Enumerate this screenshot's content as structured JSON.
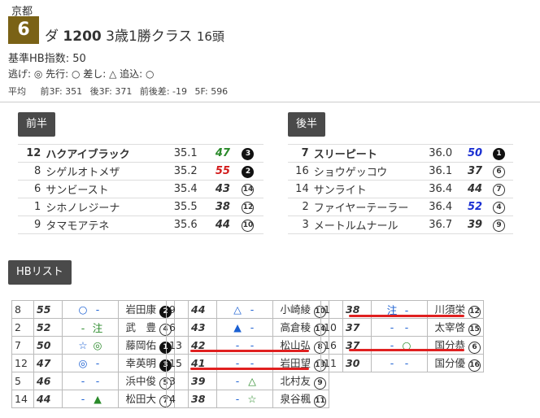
{
  "race": {
    "venue": "京都",
    "number": "6",
    "track": "ダ",
    "distance": "1200",
    "class_name": "3歳1勝クラス",
    "runners": "16頭",
    "hb_index": "基準HB指数: 50",
    "style_legend": "逃げ: ◎ 先行: ○ 差し: △ 追込: ○",
    "avg_label": "平均",
    "avg": {
      "front3f": "前3F: 351",
      "back3f": "後3F: 371",
      "diff": "前後差: -19",
      "f5": "5F: 596"
    }
  },
  "front": {
    "label": "前半",
    "rows": [
      {
        "num": "12",
        "name": "ハクアイブラック",
        "time": "35.1",
        "index": "47",
        "index_color": "#2a8a2a",
        "mark": "3",
        "mark_style": "b"
      },
      {
        "num": "8",
        "name": "シゲルオトメザ",
        "time": "35.2",
        "index": "55",
        "index_color": "#d21a1a",
        "mark": "2",
        "mark_style": "b"
      },
      {
        "num": "6",
        "name": "サンビースト",
        "time": "35.4",
        "index": "43",
        "index_color": "#333333",
        "mark": "14",
        "mark_style": "o"
      },
      {
        "num": "1",
        "name": "シホノレジーナ",
        "time": "35.5",
        "index": "38",
        "index_color": "#333333",
        "mark": "12",
        "mark_style": "o"
      },
      {
        "num": "9",
        "name": "タマモアテネ",
        "time": "35.6",
        "index": "44",
        "index_color": "#333333",
        "mark": "10",
        "mark_style": "o"
      }
    ]
  },
  "back": {
    "label": "後半",
    "rows": [
      {
        "num": "7",
        "name": "スリーピート",
        "time": "36.0",
        "index": "50",
        "index_color": "#1a2fd2",
        "mark": "1",
        "mark_style": "b"
      },
      {
        "num": "16",
        "name": "ショウゲッコウ",
        "time": "36.1",
        "index": "37",
        "index_color": "#333333",
        "mark": "6",
        "mark_style": "o"
      },
      {
        "num": "14",
        "name": "サンライト",
        "time": "36.4",
        "index": "44",
        "index_color": "#333333",
        "mark": "7",
        "mark_style": "o"
      },
      {
        "num": "2",
        "name": "ファイヤーテーラー",
        "time": "36.4",
        "index": "52",
        "index_color": "#1a2fd2",
        "mark": "4",
        "mark_style": "o"
      },
      {
        "num": "3",
        "name": "メートルムナール",
        "time": "36.7",
        "index": "39",
        "index_color": "#333333",
        "mark": "9",
        "mark_style": "o"
      }
    ]
  },
  "hb_list": {
    "label": "HBリスト",
    "columns": [
      [
        {
          "num": "8",
          "index": "55",
          "m1": "○",
          "m1c": "#1a5fd2",
          "m2": "-",
          "m2c": "#1a5fd2",
          "jockey": "岩田康",
          "rank": "2",
          "rs": "b"
        },
        {
          "num": "2",
          "index": "52",
          "m1": "-",
          "m1c": "#2a8a2a",
          "m2": "注",
          "m2c": "#2a8a2a",
          "jockey": "武　豊",
          "rank": "4",
          "rs": "o"
        },
        {
          "num": "7",
          "index": "50",
          "m1": "☆",
          "m1c": "#1a5fd2",
          "m2": "◎",
          "m2c": "#2a8a2a",
          "jockey": "藤岡佑",
          "rank": "1",
          "rs": "b"
        },
        {
          "num": "12",
          "index": "47",
          "m1": "◎",
          "m1c": "#1a5fd2",
          "m2": "-",
          "m2c": "#1a5fd2",
          "jockey": "幸英明",
          "rank": "3",
          "rs": "b"
        },
        {
          "num": "5",
          "index": "46",
          "m1": "-",
          "m1c": "#1a5fd2",
          "m2": "-",
          "m2c": "#1a5fd2",
          "jockey": "浜中俊",
          "rank": "5",
          "rs": "o"
        },
        {
          "num": "14",
          "index": "44",
          "m1": "-",
          "m1c": "#1a5fd2",
          "m2": "▲",
          "m2c": "#2a8a2a",
          "jockey": "松田大",
          "rank": "7",
          "rs": "o"
        }
      ],
      [
        {
          "num": "9",
          "index": "44",
          "m1": "△",
          "m1c": "#1a5fd2",
          "m2": "-",
          "m2c": "#1a5fd2",
          "jockey": "小崎綾",
          "rank": "10",
          "rs": "o"
        },
        {
          "num": "6",
          "index": "43",
          "m1": "▲",
          "m1c": "#1a5fd2",
          "m2": "-",
          "m2c": "#1a5fd2",
          "jockey": "高倉稜",
          "rank": "14",
          "rs": "o"
        },
        {
          "num": "13",
          "index": "42",
          "m1": "-",
          "m1c": "#1a5fd2",
          "m2": "-",
          "m2c": "#1a5fd2",
          "jockey": "松山弘",
          "rank": "8",
          "rs": "o"
        },
        {
          "num": "15",
          "index": "41",
          "m1": "-",
          "m1c": "#1a5fd2",
          "m2": "-",
          "m2c": "#1a5fd2",
          "jockey": "岩田望",
          "rank": "13",
          "rs": "o"
        },
        {
          "num": "3",
          "index": "39",
          "m1": "-",
          "m1c": "#1a5fd2",
          "m2": "△",
          "m2c": "#2a8a2a",
          "jockey": "北村友",
          "rank": "9",
          "rs": "o"
        },
        {
          "num": "4",
          "index": "38",
          "m1": "-",
          "m1c": "#1a5fd2",
          "m2": "☆",
          "m2c": "#2a8a2a",
          "jockey": "泉谷楓",
          "rank": "11",
          "rs": "o"
        }
      ],
      [
        {
          "num": "1",
          "index": "38",
          "m1": "注",
          "m1c": "#1a5fd2",
          "m2": "-",
          "m2c": "#1a5fd2",
          "jockey": "川須栄",
          "rank": "12",
          "rs": "o"
        },
        {
          "num": "10",
          "index": "37",
          "m1": "-",
          "m1c": "#1a5fd2",
          "m2": "-",
          "m2c": "#1a5fd2",
          "jockey": "太宰啓",
          "rank": "15",
          "rs": "o"
        },
        {
          "num": "16",
          "index": "37",
          "m1": "-",
          "m1c": "#1a5fd2",
          "m2": "○",
          "m2c": "#2a8a2a",
          "jockey": "国分恭",
          "rank": "6",
          "rs": "o"
        },
        {
          "num": "11",
          "index": "30",
          "m1": "-",
          "m1c": "#1a5fd2",
          "m2": "-",
          "m2c": "#1a5fd2",
          "jockey": "国分優",
          "rank": "16",
          "rs": "o"
        }
      ]
    ]
  },
  "highlight_color": "#e02020"
}
